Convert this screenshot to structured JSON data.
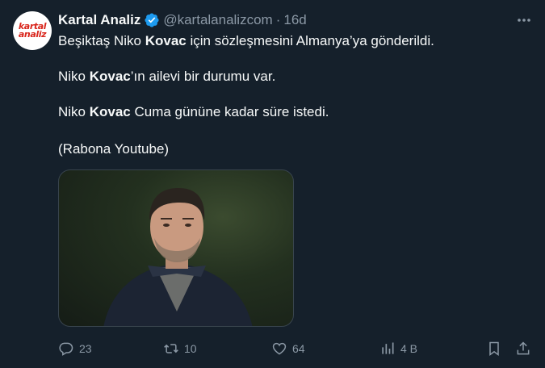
{
  "account": {
    "name": "Kartal Analiz",
    "handle": "@kartalanalizcom",
    "separator": "·",
    "time": "16d",
    "avatar_text": [
      "kartal",
      "analiz"
    ],
    "verified_icon": "verified-badge-icon",
    "accent_color": "#1d9bf0"
  },
  "tweet": {
    "line1": [
      "Beşiktaş Niko ",
      "Kovac",
      " için sözleşmesini Almanya’ya gönderildi."
    ],
    "line2": [
      "Niko ",
      "Kovac",
      "’ın ailevi bir durumu var."
    ],
    "line3": [
      "Niko ",
      "Kovac",
      " Cuma gününe kadar süre istedi."
    ],
    "line4": "(Rabona Youtube)"
  },
  "actions": {
    "reply": {
      "icon": "reply-icon",
      "count": "23"
    },
    "retweet": {
      "icon": "retweet-icon",
      "count": "10"
    },
    "like": {
      "icon": "heart-icon",
      "count": "64"
    },
    "views": {
      "icon": "views-icon",
      "count": "4 B"
    },
    "bookmark": {
      "icon": "bookmark-icon"
    },
    "share": {
      "icon": "share-icon"
    }
  },
  "colors": {
    "background": "#15202b",
    "text": "#f7f9f9",
    "secondary": "#8b98a5",
    "brand_red": "#d9261c"
  }
}
